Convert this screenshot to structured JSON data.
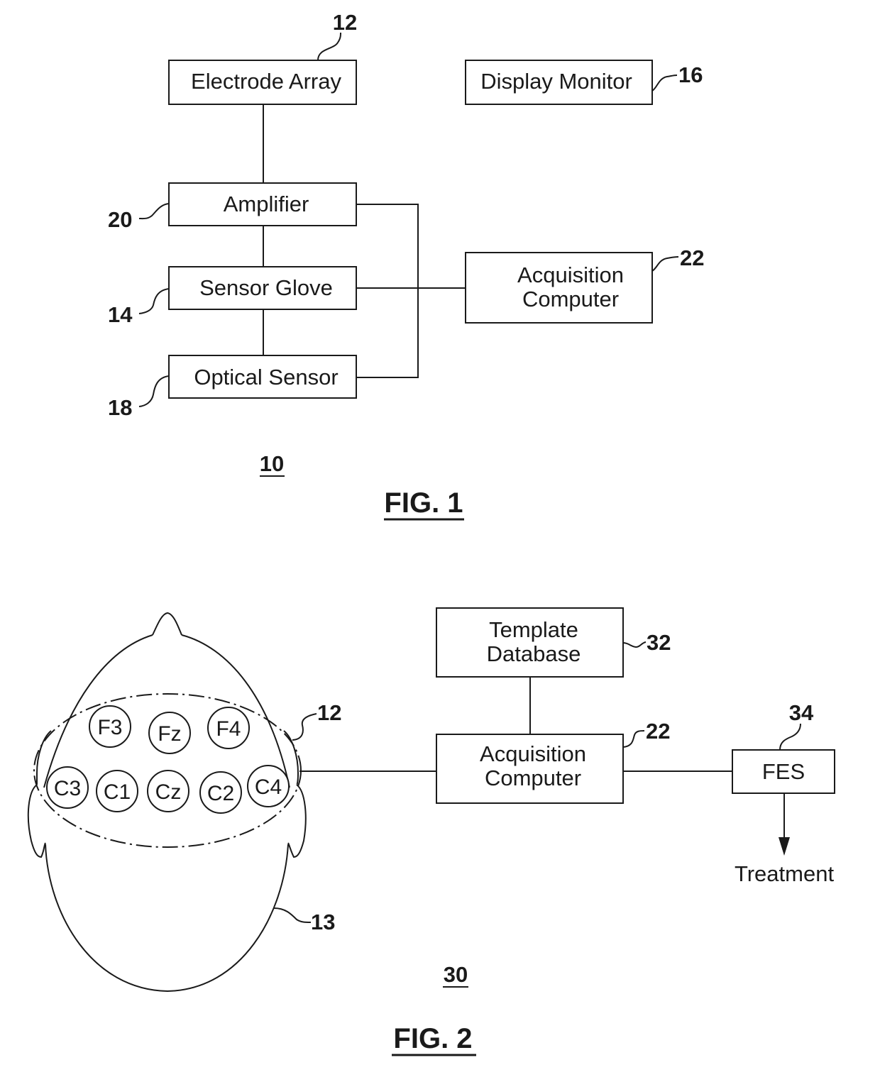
{
  "fig1": {
    "title": "FIG. 1",
    "system_ref": "10",
    "blocks": {
      "electrode_array": {
        "label": "Electrode Array",
        "ref": "12"
      },
      "display_monitor": {
        "label": "Display Monitor",
        "ref": "16"
      },
      "amplifier": {
        "label": "Amplifier",
        "ref": "20"
      },
      "sensor_glove": {
        "label": "Sensor Glove",
        "ref": "14"
      },
      "optical_sensor": {
        "label": "Optical Sensor",
        "ref": "18"
      },
      "acquisition_computer": {
        "label_line1": "Acquisition",
        "label_line2": "Computer",
        "ref": "22"
      }
    }
  },
  "fig2": {
    "title": "FIG. 2",
    "system_ref": "30",
    "head_ref": "13",
    "electrode_array_ref": "12",
    "electrodes": {
      "F3": "F3",
      "Fz": "Fz",
      "F4": "F4",
      "C3": "C3",
      "C1": "C1",
      "Cz": "Cz",
      "C2": "C2",
      "C4": "C4"
    },
    "blocks": {
      "template_database": {
        "label_line1": "Template",
        "label_line2": "Database",
        "ref": "32"
      },
      "acquisition_computer": {
        "label_line1": "Acquisition",
        "label_line2": "Computer",
        "ref": "22"
      },
      "fes": {
        "label": "FES",
        "ref": "34"
      }
    },
    "output_label": "Treatment"
  }
}
